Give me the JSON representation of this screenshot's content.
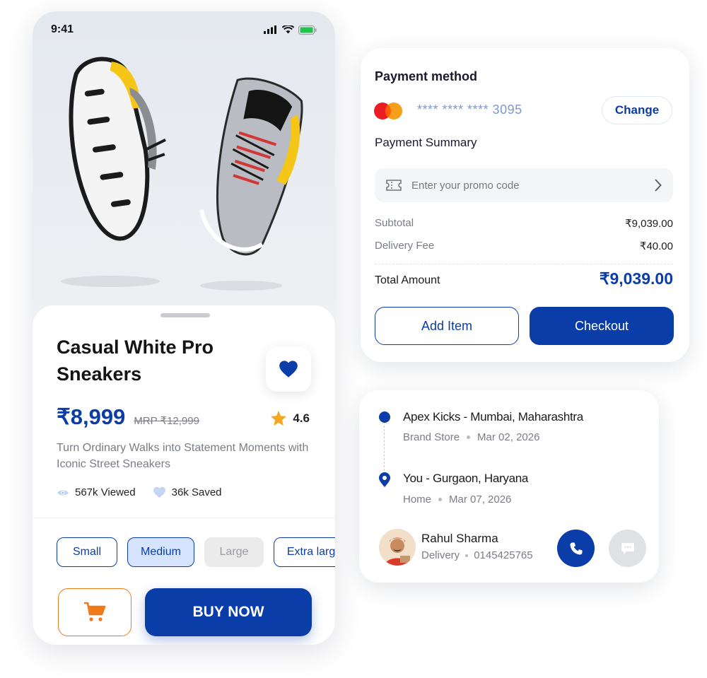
{
  "phone": {
    "status": {
      "time": "9:41"
    },
    "product": {
      "title": "Casual White Pro Sneakers",
      "price": "₹8,999",
      "mrp": "MRP ₹12,999",
      "rating": "4.6",
      "description": "Turn Ordinary Walks into Statement Moments with Iconic Street Sneakers",
      "viewed": "567k Viewed",
      "saved": "36k Saved"
    },
    "sizes": [
      {
        "label": "Small",
        "state": "default"
      },
      {
        "label": "Medium",
        "state": "selected"
      },
      {
        "label": "Large",
        "state": "disabled"
      },
      {
        "label": "Extra large",
        "state": "default"
      }
    ],
    "buy_label": "BUY NOW",
    "icons": {
      "cart": "cart-icon",
      "favorite": "heart-icon",
      "rating": "star-icon",
      "views": "eye-icon",
      "saves": "heart-icon"
    }
  },
  "payment": {
    "title": "Payment method",
    "card_number": "**** **** **** 3095",
    "change_label": "Change",
    "summary_title": "Payment Summary",
    "promo_placeholder": "Enter your promo code",
    "subtotal_label": "Subtotal",
    "subtotal_value": "₹9,039.00",
    "delivery_label": "Delivery Fee",
    "delivery_value": "₹40.00",
    "total_label": "Total Amount",
    "total_value": "₹9,039.00",
    "add_label": "Add Item",
    "checkout_label": "Checkout"
  },
  "delivery": {
    "origin": {
      "title": "Apex Kicks - Mumbai, Maharashtra",
      "type": "Brand Store",
      "date": "Mar 02, 2026"
    },
    "destination": {
      "title": "You - Gurgaon, Haryana",
      "type": "Home",
      "date": "Mar 07, 2026"
    },
    "driver": {
      "name": "Rahul Sharma",
      "role": "Delivery",
      "phone": "0145425765"
    }
  },
  "colors": {
    "brand": "#0b3da8",
    "accent_orange": "#f07a1a",
    "star": "#f5a623"
  }
}
